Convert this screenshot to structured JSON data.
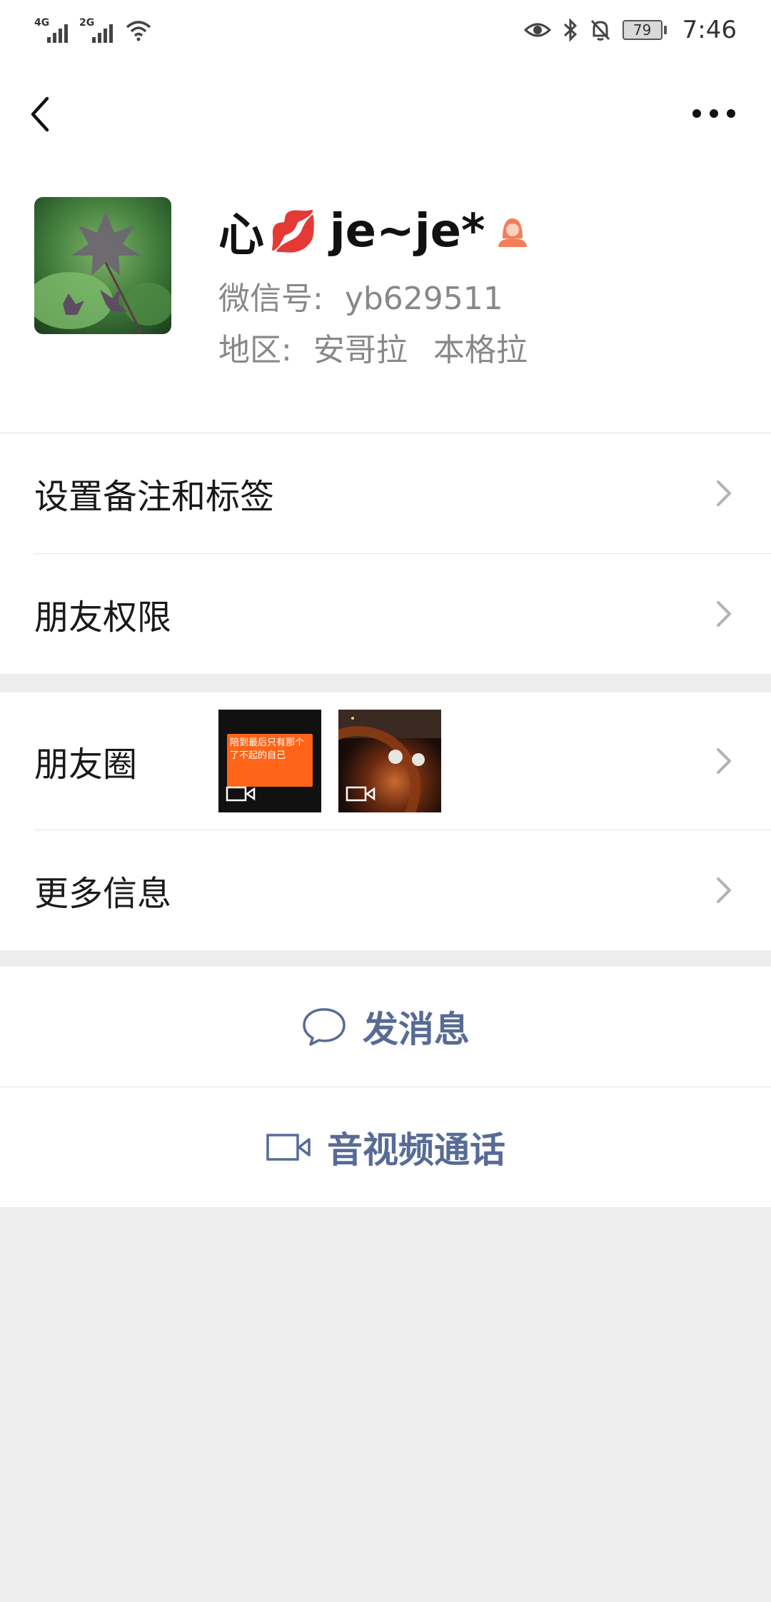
{
  "status_bar": {
    "sim1_type": "4G",
    "sim2_type": "2G",
    "battery": "79",
    "time": "7:46"
  },
  "nav": {
    "back_icon": "chevron-left-icon",
    "more_icon": "more-dots-icon"
  },
  "profile": {
    "name_prefix": "心",
    "name_emoji": "💋",
    "name_suffix": "je~je*",
    "gender_icon": "female-icon",
    "gender_color": "#f37e58",
    "wechat_id_label": "微信号:",
    "wechat_id": "yb629511",
    "region_label": "地区:",
    "region_country": "安哥拉",
    "region_city": "本格拉"
  },
  "menu": {
    "remarks_tags": "设置备注和标签",
    "friend_permissions": "朋友权限",
    "moments": "朋友圈",
    "moments_thumb1_caption": "陪到最后只有那个了不起的自己",
    "more_info": "更多信息"
  },
  "actions": {
    "send_message": "发消息",
    "av_call": "音视频通话",
    "accent_color": "#576b95"
  }
}
